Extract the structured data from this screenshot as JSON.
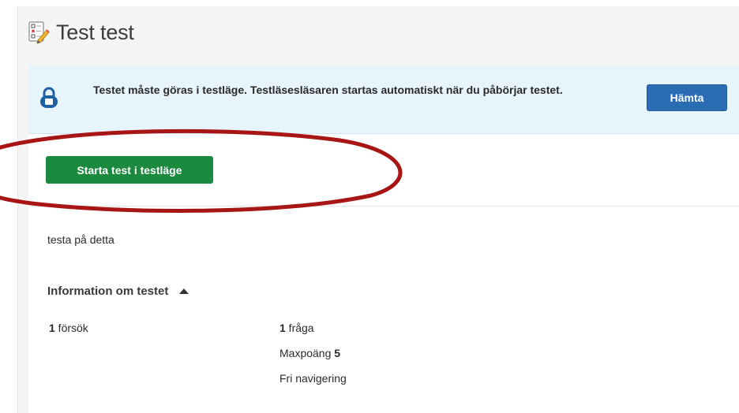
{
  "page": {
    "title": "Test test"
  },
  "alert": {
    "message": "Testet måste göras i testläge. Testläsesläsaren startas automatiskt när du påbörjar testet.",
    "fetch_label": "Hämta"
  },
  "actions": {
    "start_label": "Starta test i testläge"
  },
  "description": "testa på detta",
  "info": {
    "heading": "Information om testet",
    "attempts_count": "1",
    "attempts_label": " försök",
    "questions_count": "1",
    "questions_label": " fråga",
    "maxpoints_label": "Maxpoäng ",
    "maxpoints_value": "5",
    "navigation": "Fri navigering"
  },
  "colors": {
    "alert_bg": "#e8f4fb",
    "primary_button": "#2b6db4",
    "start_button": "#1b8a3e",
    "annotation_ring": "#a81515"
  },
  "icons": [
    "test-document-icon",
    "lock-icon",
    "caret-up-icon"
  ]
}
